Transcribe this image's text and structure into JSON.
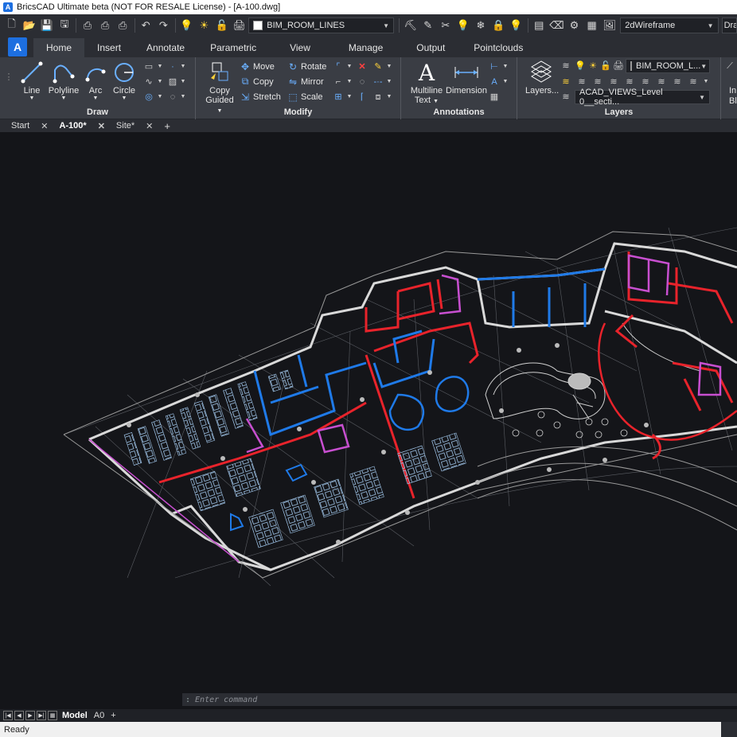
{
  "titlebar": {
    "title": "BricsCAD Ultimate beta (NOT FOR RESALE License) - [A-100.dwg]"
  },
  "qat": {
    "layer": "BIM_ROOM_LINES",
    "visual_style": "2dWireframe",
    "workspace_partial": "Dra"
  },
  "ribbon_tabs": [
    "Home",
    "Insert",
    "Annotate",
    "Parametric",
    "View",
    "Manage",
    "Output",
    "Pointclouds"
  ],
  "draw": {
    "title": "Draw",
    "line": "Line",
    "polyline": "Polyline",
    "arc": "Arc",
    "circle": "Circle"
  },
  "modify": {
    "title": "Modify",
    "copy_guided_1": "Copy",
    "copy_guided_2": "Guided",
    "move": "Move",
    "copy": "Copy",
    "stretch": "Stretch",
    "rotate": "Rotate",
    "mirror": "Mirror",
    "scale": "Scale"
  },
  "annotations": {
    "title": "Annotations",
    "mtext_1": "Multiline",
    "mtext_2": "Text",
    "dimension": "Dimension"
  },
  "layers": {
    "title": "Layers",
    "layers_btn": "Layers...",
    "current": "BIM_ROOM_L...",
    "view_layer": "ACAD_VIEWS_Level 0__secti...",
    "partial_1": "In",
    "partial_2": "Bl"
  },
  "doc_tabs": [
    {
      "label": "Start"
    },
    {
      "label": "A-100*"
    },
    {
      "label": "Site*"
    }
  ],
  "cmdline": {
    "prompt": ":",
    "placeholder": "Enter command"
  },
  "layout_tabs": {
    "model": "Model",
    "a0": "A0",
    "add": "+"
  },
  "statusbar": {
    "text": "Ready"
  },
  "colors": {
    "accent": "#1d6fe0",
    "wall": "#d9d9d9",
    "red_walls": "#e8232b",
    "blue_walls": "#1f7ae8",
    "magenta_walls": "#c84fd0",
    "furniture": "#9fc4e8"
  }
}
